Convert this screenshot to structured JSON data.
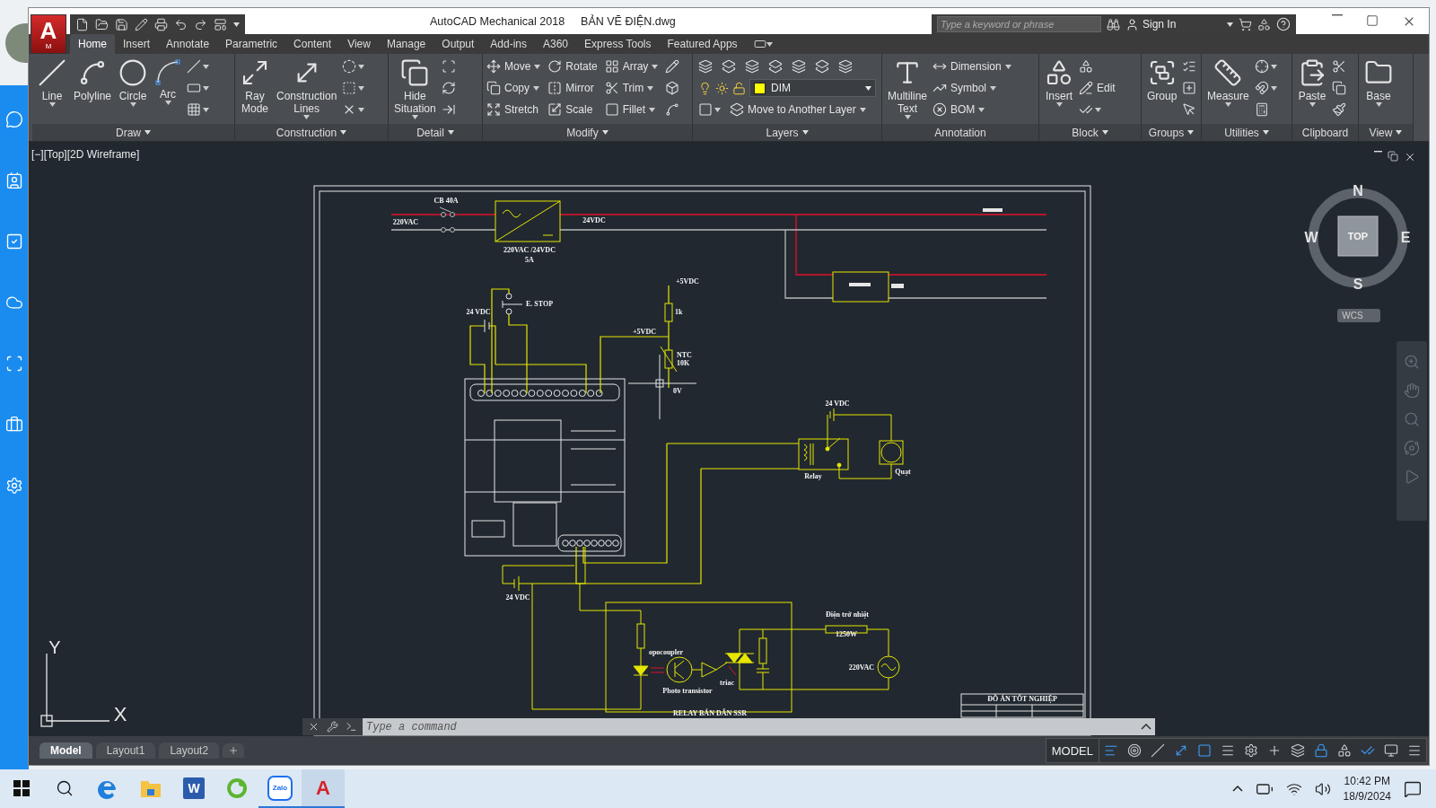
{
  "window": {
    "app": "AutoCAD Mechanical 2018",
    "file": "BẢN VẼ ĐIỆN.dwg",
    "app_letter": "A",
    "app_sub": "M"
  },
  "search": {
    "placeholder": "Type a keyword or phrase"
  },
  "account": {
    "label": "Sign In"
  },
  "ribbon_tabs": [
    {
      "label": "Home",
      "selected": true
    },
    {
      "label": "Insert",
      "selected": false
    },
    {
      "label": "Annotate",
      "selected": false
    },
    {
      "label": "Parametric",
      "selected": false
    },
    {
      "label": "Content",
      "selected": false
    },
    {
      "label": "View",
      "selected": false
    },
    {
      "label": "Manage",
      "selected": false
    },
    {
      "label": "Output",
      "selected": false
    },
    {
      "label": "Add-ins",
      "selected": false
    },
    {
      "label": "A360",
      "selected": false
    },
    {
      "label": "Express Tools",
      "selected": false
    },
    {
      "label": "Featured Apps",
      "selected": false
    }
  ],
  "panels": [
    {
      "title": "Draw",
      "menu": true,
      "kind": "columns",
      "tools": [
        {
          "kind": "large",
          "label": "Line",
          "dropdown": true
        },
        {
          "kind": "large",
          "label": "Polyline",
          "dropdown": false
        },
        {
          "kind": "large",
          "label": "Circle",
          "dropdown": true
        },
        {
          "kind": "large",
          "label": "Arc",
          "dropdown": true
        },
        {
          "kind": "icon",
          "dropdown": true
        },
        {
          "kind": "icon",
          "dropdown": true
        },
        {
          "kind": "icon",
          "dropdown": true
        }
      ]
    },
    {
      "title": "Construction",
      "menu": true,
      "kind": "columns",
      "tools": [
        {
          "kind": "large",
          "label": "Ray Mode",
          "dropdown": false
        },
        {
          "kind": "large",
          "label": "Construction Lines",
          "dropdown": true
        },
        {
          "kind": "icon",
          "dropdown": true
        },
        {
          "kind": "icon",
          "dropdown": true
        },
        {
          "kind": "icon",
          "dropdown": true
        }
      ]
    },
    {
      "title": "Detail",
      "menu": true,
      "kind": "columns",
      "tools": [
        {
          "kind": "large",
          "label": "Hide Situation",
          "dropdown": true
        },
        {
          "kind": "icon",
          "dropdown": false
        },
        {
          "kind": "icon",
          "dropdown": false
        },
        {
          "kind": "icon",
          "dropdown": false
        }
      ]
    },
    {
      "title": "Modify",
      "menu": true,
      "kind": "columns",
      "tools": [
        {
          "kind": "small",
          "label": "Move",
          "dropdown": true
        },
        {
          "kind": "small",
          "label": "Copy",
          "dropdown": true
        },
        {
          "kind": "small",
          "label": "Stretch",
          "dropdown": false
        },
        {
          "kind": "small",
          "label": "Rotate",
          "dropdown": false
        },
        {
          "kind": "small",
          "label": "Mirror",
          "dropdown": false
        },
        {
          "kind": "small",
          "label": "Scale",
          "dropdown": false
        },
        {
          "kind": "small",
          "label": "Array",
          "dropdown": true
        },
        {
          "kind": "small",
          "label": "Trim",
          "dropdown": true
        },
        {
          "kind": "small",
          "label": "Fillet",
          "dropdown": true
        },
        {
          "kind": "icon",
          "dropdown": false
        },
        {
          "kind": "icon",
          "dropdown": false
        },
        {
          "kind": "icon",
          "dropdown": false
        }
      ]
    },
    {
      "title": "Layers",
      "menu": true,
      "kind": "rows",
      "tools": [
        {
          "kind": "icon",
          "dropdown": false
        },
        {
          "kind": "icon",
          "dropdown": false
        },
        {
          "kind": "icon",
          "dropdown": false
        },
        {
          "kind": "icon",
          "dropdown": false
        },
        {
          "kind": "icon",
          "dropdown": false
        },
        {
          "kind": "icon",
          "dropdown": false
        },
        {
          "kind": "icon",
          "dropdown": false
        },
        {
          "kind": "layer-select",
          "label": "DIM",
          "dropdown": true
        },
        {
          "kind": "icon",
          "dropdown": true
        },
        {
          "kind": "small",
          "label": "Move to Another Layer",
          "dropdown": true
        }
      ]
    },
    {
      "title": "Annotation",
      "menu": false,
      "kind": "columns",
      "tools": [
        {
          "kind": "large",
          "label": "Multiline Text",
          "dropdown": true
        },
        {
          "kind": "small",
          "label": "Dimension",
          "dropdown": true
        },
        {
          "kind": "small",
          "label": "Symbol",
          "dropdown": true
        },
        {
          "kind": "small",
          "label": "BOM",
          "dropdown": true
        }
      ]
    },
    {
      "title": "Block",
      "menu": true,
      "kind": "columns",
      "tools": [
        {
          "kind": "large",
          "label": "Insert",
          "dropdown": true
        },
        {
          "kind": "icon",
          "dropdown": false
        },
        {
          "kind": "small",
          "label": "Edit",
          "dropdown": false
        },
        {
          "kind": "icon",
          "dropdown": true
        }
      ]
    },
    {
      "title": "Groups",
      "menu": true,
      "kind": "columns",
      "tools": [
        {
          "kind": "large",
          "label": "Group",
          "dropdown": false
        },
        {
          "kind": "icon",
          "dropdown": false
        },
        {
          "kind": "icon",
          "dropdown": false
        },
        {
          "kind": "icon",
          "dropdown": false
        }
      ]
    },
    {
      "title": "Utilities",
      "menu": true,
      "kind": "columns",
      "tools": [
        {
          "kind": "large",
          "label": "Measure",
          "dropdown": true
        },
        {
          "kind": "icon",
          "dropdown": true
        },
        {
          "kind": "icon",
          "dropdown": true
        },
        {
          "kind": "icon",
          "dropdown": false
        }
      ]
    },
    {
      "title": "Clipboard",
      "menu": false,
      "kind": "columns",
      "tools": [
        {
          "kind": "large",
          "label": "Paste",
          "dropdown": true
        },
        {
          "kind": "icon",
          "dropdown": false
        },
        {
          "kind": "icon",
          "dropdown": false
        },
        {
          "kind": "icon",
          "dropdown": false
        }
      ]
    },
    {
      "title": "View",
      "menu": true,
      "kind": "columns",
      "tools": [
        {
          "kind": "large",
          "label": "Base",
          "dropdown": true
        }
      ]
    }
  ],
  "viewport": {
    "label": "[−][Top][2D Wireframe]"
  },
  "drawing": {
    "labels": {
      "breaker": "CB 40A",
      "ac_in": "220VAC",
      "psu_rating": "220VAC /24VDC",
      "psu_current": "5A",
      "dc_out": "24VDC",
      "estop": "E. STOP",
      "plc_supply": "24 VDC",
      "sensor_supply": "+5VDC",
      "resistor": "1k",
      "sensor_signal": "+5VDC",
      "ntc": "NTC",
      "ntc_value": "10K",
      "ground": "0V",
      "relay_supply": "24 VDC",
      "relay": "Relay",
      "fan": "Quạt",
      "output_supply": "24 VDC",
      "optocoupler": "opocoupler",
      "phototransistor": "Photo transistor",
      "triac": "triac",
      "heater": "Điện trở nhiệt",
      "heater_power": "1250W",
      "mains": "220VAC",
      "circuit_title": "RELAY BÁN DẪN SSR",
      "title_block": "ĐỒ ÁN TỐT NGHIỆP"
    }
  },
  "viewcube": {
    "north": "N",
    "west": "W",
    "east": "E",
    "south": "S",
    "face": "TOP",
    "ucs": "WCS"
  },
  "ucs_icon": {
    "y": "Y",
    "x": "X"
  },
  "command_line": {
    "placeholder": "Type a command"
  },
  "layout_tabs": [
    {
      "label": "Model",
      "selected": true
    },
    {
      "label": "Layout1",
      "selected": false
    },
    {
      "label": "Layout2",
      "selected": false
    }
  ],
  "status_bar": {
    "space": "MODEL"
  },
  "taskbar": {
    "apps": [
      {
        "kind": "edge",
        "open": false,
        "selected": false
      },
      {
        "kind": "explorer",
        "open": false,
        "selected": false
      },
      {
        "kind": "word",
        "text": "W",
        "open": false,
        "selected": false
      },
      {
        "kind": "coccoc",
        "open": false,
        "selected": false
      },
      {
        "kind": "zalo",
        "text": "Zalo",
        "open": true,
        "selected": false
      },
      {
        "kind": "autocad",
        "text": "A",
        "open": true,
        "selected": true
      }
    ],
    "time": "10:42 PM",
    "date": "18/9/2024"
  }
}
